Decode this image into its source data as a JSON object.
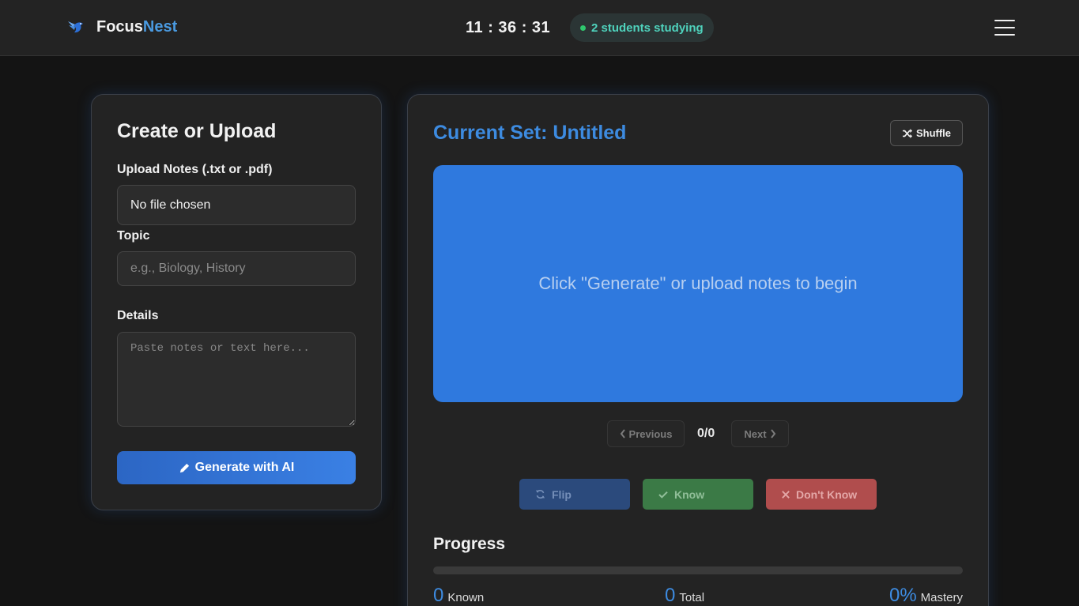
{
  "header": {
    "brand_main": "Focus",
    "brand_accent": "Nest",
    "clock": "11 : 36 : 31",
    "status_text": "2 students studying",
    "colors": {
      "accent": "#4a9ae0",
      "status_dot": "#2fc86e",
      "status_text": "#4fd3bd"
    }
  },
  "create_panel": {
    "title": "Create or Upload",
    "upload_label": "Upload Notes (.txt or .pdf)",
    "file_value": "No file chosen",
    "topic_label": "Topic",
    "topic_placeholder": "e.g., Biology, History",
    "details_label": "Details",
    "details_placeholder": "Paste notes or text here...",
    "generate_label": "Generate with AI",
    "generate_icon": "pencil-icon"
  },
  "flashcards": {
    "set_title": "Current Set: Untitled",
    "shuffle_label": "Shuffle",
    "shuffle_icon": "shuffle-icon",
    "card_text": "Click \"Generate\" or upload notes to begin",
    "card_color": "#2f79de",
    "prev_label": "Previous",
    "next_label": "Next",
    "counter": "0/0",
    "flip_label": "Flip",
    "know_label": "Know",
    "dont_know_label": "Don't Know"
  },
  "progress": {
    "title": "Progress",
    "fraction": 0,
    "known_value": "0",
    "known_label": "Known",
    "total_value": "0",
    "total_label": "Total",
    "mastery_value": "0%",
    "mastery_label": "Mastery"
  }
}
